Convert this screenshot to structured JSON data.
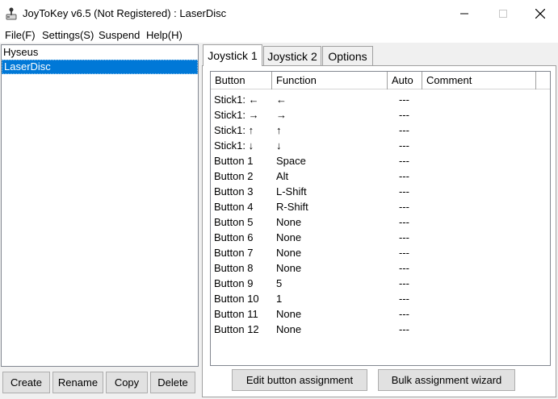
{
  "window": {
    "title": "JoyToKey v6.5 (Not Registered) : LaserDisc"
  },
  "menu": [
    "File(F)",
    "Settings(S)",
    "Suspend",
    "Help(H)"
  ],
  "profiles": {
    "items": [
      "Hyseus",
      "LaserDisc"
    ],
    "selected": "LaserDisc",
    "buttons": [
      "Create",
      "Rename",
      "Copy",
      "Delete"
    ]
  },
  "tabs": [
    "Joystick 1",
    "Joystick 2",
    "Options"
  ],
  "active_tab": "Joystick 1",
  "grid": {
    "columns": [
      "Button",
      "Function",
      "Auto",
      "Comment"
    ],
    "rows": [
      {
        "button": "Stick1: ←",
        "function": "←",
        "auto": "---",
        "comment": ""
      },
      {
        "button": "Stick1: →",
        "function": "→",
        "auto": "---",
        "comment": ""
      },
      {
        "button": "Stick1: ↑",
        "function": "↑",
        "auto": "---",
        "comment": ""
      },
      {
        "button": "Stick1: ↓",
        "function": "↓",
        "auto": "---",
        "comment": ""
      },
      {
        "button": "Button 1",
        "function": "Space",
        "auto": "---",
        "comment": ""
      },
      {
        "button": "Button 2",
        "function": "Alt",
        "auto": "---",
        "comment": ""
      },
      {
        "button": "Button 3",
        "function": "L-Shift",
        "auto": "---",
        "comment": ""
      },
      {
        "button": "Button 4",
        "function": "R-Shift",
        "auto": "---",
        "comment": ""
      },
      {
        "button": "Button 5",
        "function": "None",
        "auto": "---",
        "comment": ""
      },
      {
        "button": "Button 6",
        "function": "None",
        "auto": "---",
        "comment": ""
      },
      {
        "button": "Button 7",
        "function": "None",
        "auto": "---",
        "comment": ""
      },
      {
        "button": "Button 8",
        "function": "None",
        "auto": "---",
        "comment": ""
      },
      {
        "button": "Button 9",
        "function": "5",
        "auto": "---",
        "comment": ""
      },
      {
        "button": "Button 10",
        "function": "1",
        "auto": "---",
        "comment": ""
      },
      {
        "button": "Button 11",
        "function": "None",
        "auto": "---",
        "comment": ""
      },
      {
        "button": "Button 12",
        "function": "None",
        "auto": "---",
        "comment": ""
      }
    ]
  },
  "actions": {
    "edit": "Edit button assignment",
    "bulk": "Bulk assignment wizard"
  },
  "colors": {
    "selection": "#0078d7",
    "button_face": "#e1e1e1",
    "window_bg": "#f0f0f0"
  }
}
